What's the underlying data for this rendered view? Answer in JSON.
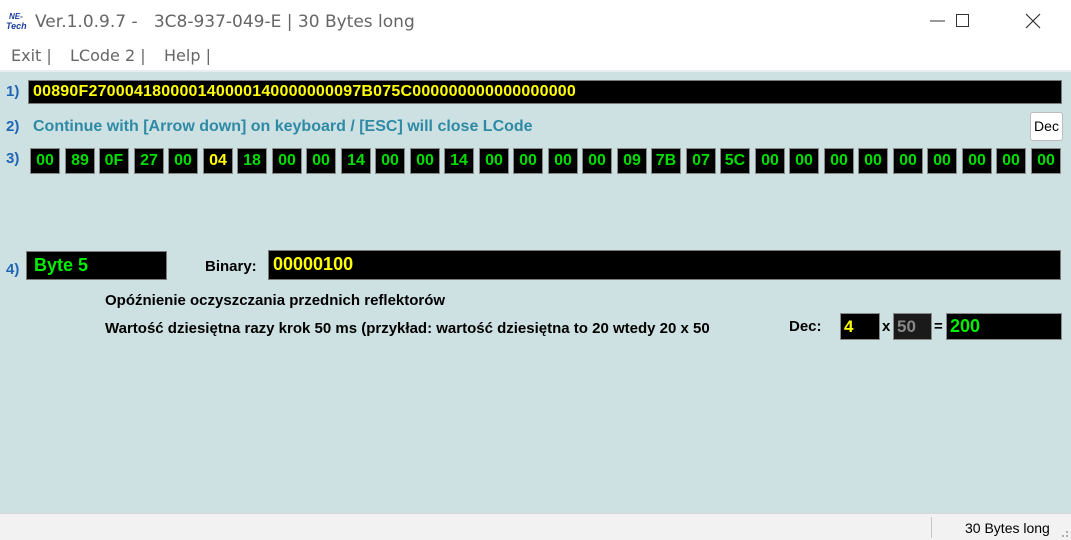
{
  "window": {
    "title": "Ver.1.0.9.7 -   3C8-937-049-E | 30 Bytes long",
    "logo_icon": "ne-tech-logo-icon",
    "controls": [
      "minimize-icon",
      "maximize-icon",
      "close-icon"
    ]
  },
  "menu": {
    "items": [
      "Exit |",
      "LCode 2 |",
      "Help |"
    ]
  },
  "row1": {
    "number": "1)",
    "hex_string": "00890F270004180000140000140000000097B075C000000000000000000"
  },
  "row2": {
    "number": "2)",
    "instruction": "Continue with [Arrow down] on keyboard / [ESC] will close LCode",
    "dec_button": "Dec"
  },
  "row3": {
    "number": "3)",
    "bytes": [
      "00",
      "89",
      "0F",
      "27",
      "00",
      "04",
      "18",
      "00",
      "00",
      "14",
      "00",
      "00",
      "14",
      "00",
      "00",
      "00",
      "00",
      "09",
      "7B",
      "07",
      "5C",
      "00",
      "00",
      "00",
      "00",
      "00",
      "00",
      "00",
      "00",
      "00"
    ],
    "selected_index": 5,
    "colors": {
      "normal": "#00dd00",
      "selected": "#ffff00"
    }
  },
  "row4": {
    "number": "4)",
    "byte_label": "Byte 5",
    "binary_label": "Binary:",
    "binary_value": "00000100"
  },
  "description": {
    "line1": "Opóźnienie oczyszczania przednich reflektorów",
    "line2": "Wartość dziesiętna razy krok 50 ms (przykład: wartość dziesiętna to 20 wtedy 20 x 50",
    "overlap_label": "Dec:",
    "multiplier_symbol": "x",
    "equals_symbol": "=",
    "dec_value": "4",
    "step_value": "50",
    "result": "200"
  },
  "status": {
    "text": "30 Bytes long"
  }
}
